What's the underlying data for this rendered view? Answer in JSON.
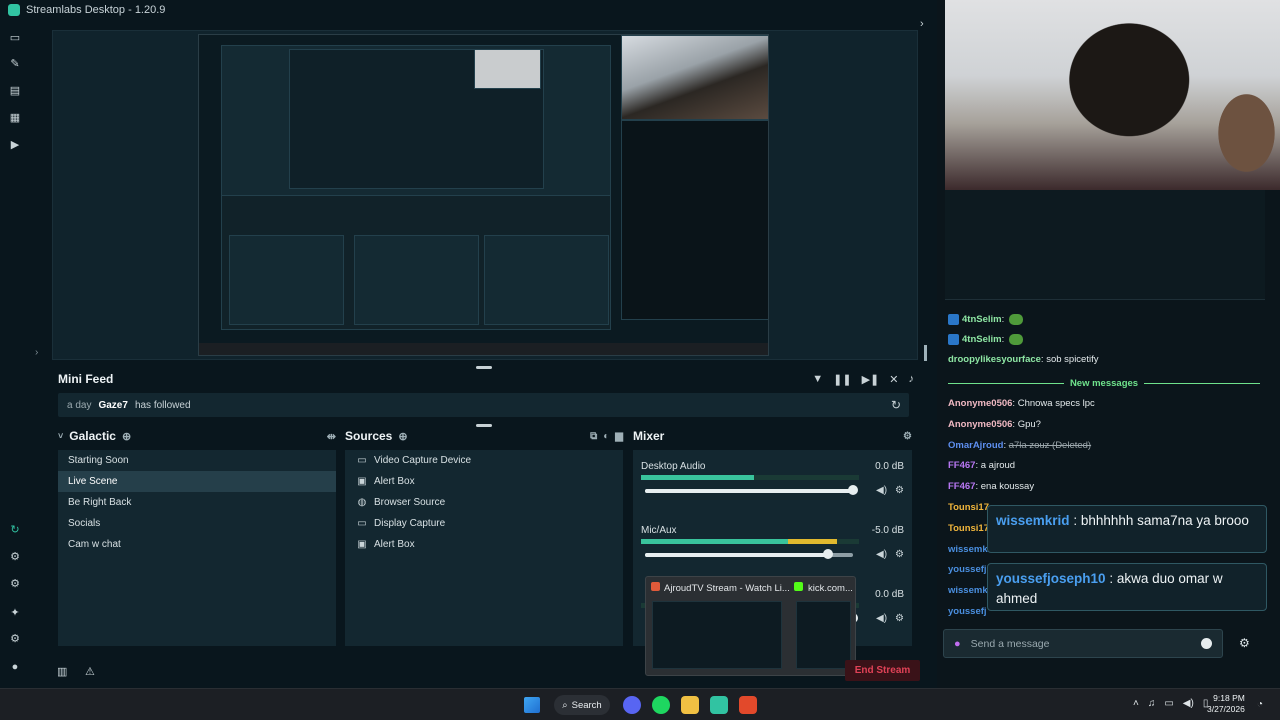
{
  "window": {
    "title": "Streamlabs Desktop - 1.20.9"
  },
  "mini_feed": {
    "title": "Mini Feed",
    "time": "a day",
    "user": "Gaze7",
    "action": "has followed"
  },
  "scenes": {
    "collection": "Galactic",
    "items": [
      "Starting Soon",
      "Live Scene",
      "Be Right Back",
      "Socials",
      "Cam w chat"
    ],
    "active": "Live Scene"
  },
  "sources": {
    "title": "Sources",
    "items": [
      {
        "label": "Video Capture Device",
        "icon": "camera-icon"
      },
      {
        "label": "Alert Box",
        "icon": "alert-box-icon"
      },
      {
        "label": "Browser Source",
        "icon": "globe-icon"
      },
      {
        "label": "Display Capture",
        "icon": "monitor-icon"
      },
      {
        "label": "Alert Box",
        "icon": "alert-box-icon"
      }
    ]
  },
  "mixer": {
    "title": "Mixer",
    "channels": [
      {
        "name": "Desktop Audio",
        "db": "0.0 dB",
        "meter": 0.52,
        "volume": 1.0
      },
      {
        "name": "Mic/Aux",
        "db": "-5.0 dB",
        "meter": 0.9,
        "volume": 0.88
      },
      {
        "name": "",
        "db": "0.0 dB",
        "meter": 0,
        "volume": 1.0
      }
    ]
  },
  "taskbar_preview": {
    "item1": "AjroudTV Stream - Watch Li...",
    "item2": "kick.com..."
  },
  "footer": {
    "end_stream": "End Stream"
  },
  "chat": {
    "messages": [
      {
        "user": "4tnSelim",
        "sep": ":",
        "text": "",
        "color": "u-green",
        "badge": true,
        "emote": true
      },
      {
        "user": "4tnSelim",
        "sep": ":",
        "text": "",
        "color": "u-green",
        "badge": true,
        "emote": true
      },
      {
        "user": "droopylikesyourface",
        "sep": ":",
        "text": "sob spicetify",
        "color": "u-green",
        "badge": false,
        "emote": false
      }
    ],
    "new_messages_label": "New messages",
    "after": [
      {
        "user": "Anonyme0506",
        "text": "Chnowa specs lpc",
        "color": "u-pink"
      },
      {
        "user": "Anonyme0506",
        "text": "Gpu?",
        "color": "u-pink"
      },
      {
        "user": "OmarAjroud",
        "text": "a7la zouz (Deleted)",
        "color": "u-blue",
        "deleted": true
      },
      {
        "user": "FF467",
        "text": "a ajroud",
        "color": "u-purple"
      },
      {
        "user": "FF467",
        "text": "ena koussay",
        "color": "u-purple"
      },
      {
        "user": "Tounsi17",
        "text": "",
        "color": "u-orange"
      },
      {
        "user": "Tounsi17",
        "text": "",
        "color": "u-orange"
      },
      {
        "user": "wissemk",
        "text": "",
        "color": "u-bluelink"
      },
      {
        "user": "youssefj",
        "text": "",
        "color": "u-bluelink"
      },
      {
        "user": "wissemk",
        "text": "",
        "color": "u-bluelink"
      },
      {
        "user": "youssefj",
        "text": "",
        "color": "u-bluelink"
      }
    ],
    "toasts": [
      {
        "user": "wissemkrid",
        "text": ": bhhhhhh sama7na ya brooo"
      },
      {
        "user": "youssefjoseph10",
        "text": ": akwa duo omar w ahmed"
      }
    ],
    "send_placeholder": "Send a message"
  },
  "taskbar": {
    "search_label": "Search",
    "time": "9:18 PM",
    "date": "3/27/2026"
  }
}
